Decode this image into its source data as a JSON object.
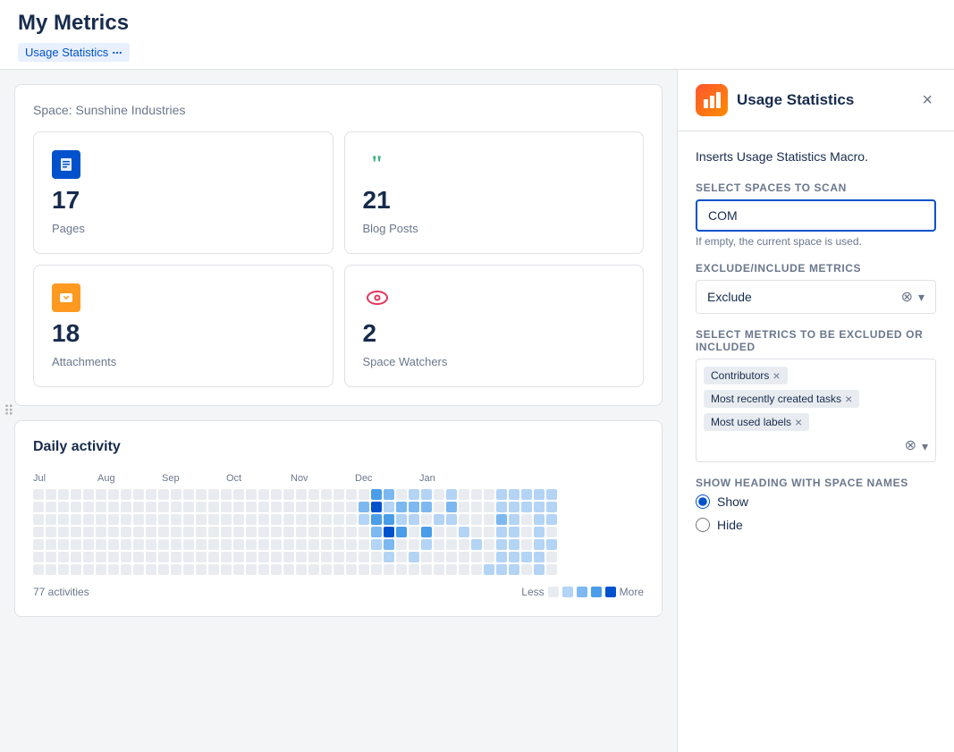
{
  "header": {
    "title": "My Metrics",
    "breadcrumb": "Usage Statistics"
  },
  "leftPanel": {
    "spaceTitle": "Space: Sunshine Industries",
    "metrics": [
      {
        "id": "pages",
        "value": "17",
        "label": "Pages",
        "iconType": "blue-pages"
      },
      {
        "id": "blogposts",
        "value": "21",
        "label": "Blog Posts",
        "iconType": "green-quote"
      },
      {
        "id": "attachments",
        "value": "18",
        "label": "Attachments",
        "iconType": "yellow-image"
      },
      {
        "id": "watchers",
        "value": "2",
        "label": "Space Watchers",
        "iconType": "pink-eye"
      }
    ],
    "activityTitle": "Daily activity",
    "activityCount": "77 activities",
    "months": [
      "Jul",
      "Aug",
      "Sep",
      "Oct",
      "Nov",
      "Dec",
      "Jan"
    ],
    "legend": {
      "less": "Less",
      "more": "More"
    }
  },
  "rightPanel": {
    "title": "Usage Statistics",
    "description": "Inserts Usage Statistics Macro.",
    "form": {
      "spacesLabel": "Select spaces to scan",
      "spacesValue": "COM",
      "spacesHint": "If empty, the current space is used.",
      "metricsLabel": "Exclude/Include metrics",
      "metricsValue": "Exclude",
      "metricsSelectLabel": "Select metrics to be excluded or included",
      "tags": [
        "Contributors",
        "Most recently created tasks",
        "Most used labels"
      ],
      "headingLabel": "Show heading with space names",
      "headingOptions": [
        {
          "value": "show",
          "label": "Show",
          "checked": true
        },
        {
          "value": "hide",
          "label": "Hide",
          "checked": false
        }
      ]
    },
    "closeLabel": "×"
  }
}
